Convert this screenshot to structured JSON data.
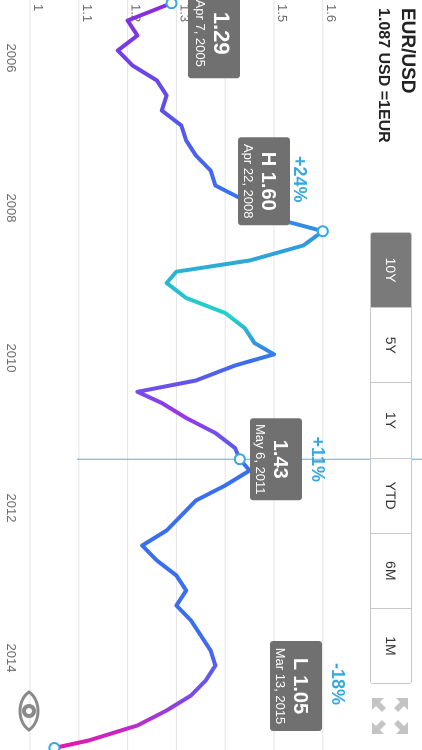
{
  "header": {
    "pair": "EUR/USD",
    "rate": "1.087 USD =1EUR"
  },
  "range_tabs": [
    {
      "label": "10Y",
      "active": true
    },
    {
      "label": "5Y",
      "active": false
    },
    {
      "label": "1Y",
      "active": false
    },
    {
      "label": "YTD",
      "active": false
    },
    {
      "label": "6M",
      "active": false
    },
    {
      "label": "1M",
      "active": false
    }
  ],
  "icons": {
    "expand": "expand-arrows-icon",
    "eye": "eye-icon"
  },
  "colors": {
    "line_start": "#3a6ef0",
    "line_mid": "#9b34e8",
    "line_high": "#22d4c8",
    "line_low": "#e816b0",
    "accent": "#35a8e0",
    "label_bg": "#707070"
  },
  "annotations": {
    "start": {
      "value": "1.29",
      "date": "Apr 7, 2005"
    },
    "high": {
      "prefix": "H",
      "value": "1.60",
      "date": "Apr 22, 2008",
      "change": "+24%"
    },
    "cursor": {
      "value": "1.43",
      "date": "May 6, 2011",
      "change": "+11%"
    },
    "low": {
      "prefix": "L",
      "value": "1.05",
      "date": "Mar 13, 2015",
      "change": "-18%"
    }
  },
  "chart_data": {
    "type": "line",
    "title": "EUR/USD",
    "ylabel": "",
    "xlabel": "",
    "y_ticks": [
      "1",
      "1.1",
      "1.2",
      "1.3",
      "1.4",
      "1.5",
      "1.6"
    ],
    "x_ticks": [
      "2006",
      "2008",
      "2010",
      "2012",
      "2014"
    ],
    "ylim": [
      1.0,
      1.6
    ],
    "xlim": [
      2005.0,
      2015.5
    ],
    "x": [
      2005.27,
      2005.5,
      2005.7,
      2005.9,
      2006.1,
      2006.3,
      2006.5,
      2006.7,
      2006.9,
      2007.1,
      2007.3,
      2007.5,
      2007.7,
      2007.9,
      2008.1,
      2008.31,
      2008.5,
      2008.7,
      2008.85,
      2009.0,
      2009.2,
      2009.4,
      2009.6,
      2009.8,
      2009.95,
      2010.1,
      2010.3,
      2010.45,
      2010.6,
      2010.8,
      2011.0,
      2011.2,
      2011.35,
      2011.5,
      2011.7,
      2011.9,
      2012.1,
      2012.3,
      2012.5,
      2012.7,
      2012.9,
      2013.1,
      2013.3,
      2013.5,
      2013.7,
      2013.9,
      2014.1,
      2014.3,
      2014.5,
      2014.7,
      2014.9,
      2015.1,
      2015.2
    ],
    "values": [
      1.29,
      1.2,
      1.22,
      1.18,
      1.21,
      1.26,
      1.28,
      1.27,
      1.31,
      1.32,
      1.34,
      1.37,
      1.38,
      1.44,
      1.48,
      1.6,
      1.56,
      1.45,
      1.3,
      1.28,
      1.32,
      1.4,
      1.44,
      1.46,
      1.5,
      1.42,
      1.34,
      1.22,
      1.27,
      1.32,
      1.38,
      1.42,
      1.43,
      1.45,
      1.4,
      1.34,
      1.31,
      1.28,
      1.23,
      1.26,
      1.3,
      1.32,
      1.3,
      1.33,
      1.35,
      1.37,
      1.38,
      1.36,
      1.33,
      1.28,
      1.22,
      1.12,
      1.05
    ]
  }
}
